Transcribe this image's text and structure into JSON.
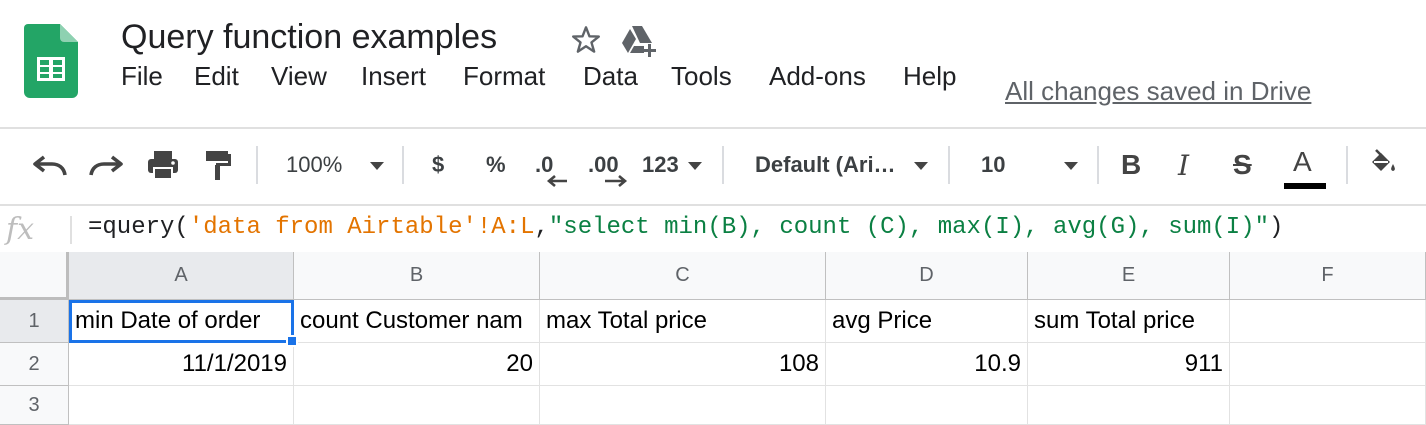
{
  "doc": {
    "title": "Query function examples",
    "save_status": "All changes saved in Drive"
  },
  "icons": {
    "logo": "google-sheets-logo",
    "star": "star-icon",
    "drive": "add-to-drive-icon"
  },
  "menu": [
    "File",
    "Edit",
    "View",
    "Insert",
    "Format",
    "Data",
    "Tools",
    "Add-ons",
    "Help"
  ],
  "toolbar": {
    "zoom": "100%",
    "currency": "$",
    "percent": "%",
    "decrease_decimals": ".0",
    "increase_decimals": ".00",
    "more_formats": "123",
    "font": "Default (Ari…",
    "font_size": "10",
    "bold": "B",
    "italic": "I",
    "strikethrough": "S",
    "text_color_letter": "A"
  },
  "formula_bar": {
    "fx": "fx",
    "prefix": "=query(",
    "range": "'data from Airtable'!A:L",
    "comma": ",",
    "query": "\"select min(B), count (C), max(I), avg(G), sum(I)\"",
    "suffix": ")"
  },
  "sheet": {
    "columns": [
      "A",
      "B",
      "C",
      "D",
      "E",
      "F"
    ],
    "rows": [
      "1",
      "2",
      "3"
    ],
    "cells": {
      "r1": [
        "min Date of order",
        "count Customer nam",
        "max Total price",
        "avg Price",
        "sum Total price",
        ""
      ],
      "r2": [
        "11/1/2019",
        "20",
        "108",
        "10.9",
        "911",
        ""
      ],
      "r3": [
        "",
        "",
        "",
        "",
        "",
        ""
      ]
    },
    "selected_cell": "A1"
  }
}
